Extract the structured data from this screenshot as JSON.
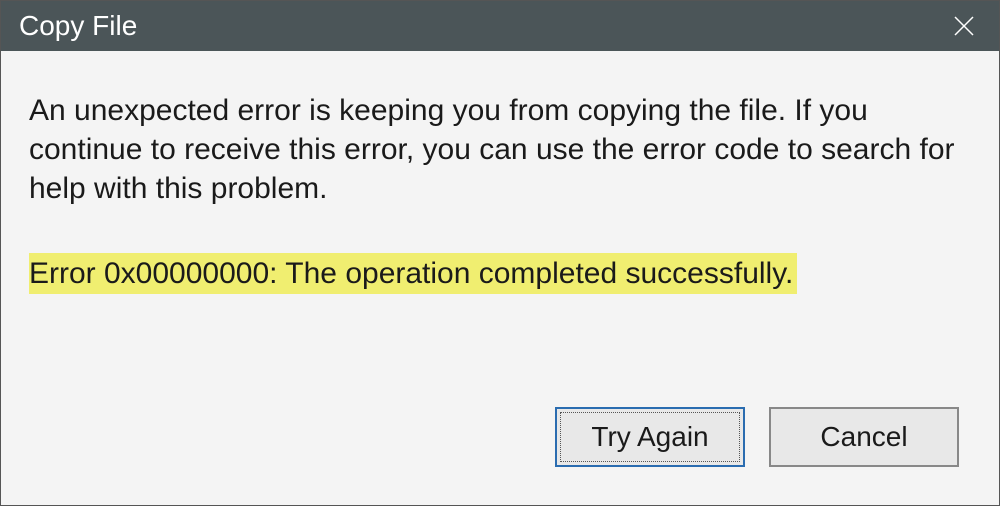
{
  "titlebar": {
    "title": "Copy File"
  },
  "content": {
    "message": "An unexpected error is keeping you from copying the file. If you continue to receive this error, you can use the error code to search for help with this problem.",
    "error_text": "Error 0x00000000: The operation completed successfully."
  },
  "buttons": {
    "try_again": "Try Again",
    "cancel": "Cancel"
  }
}
